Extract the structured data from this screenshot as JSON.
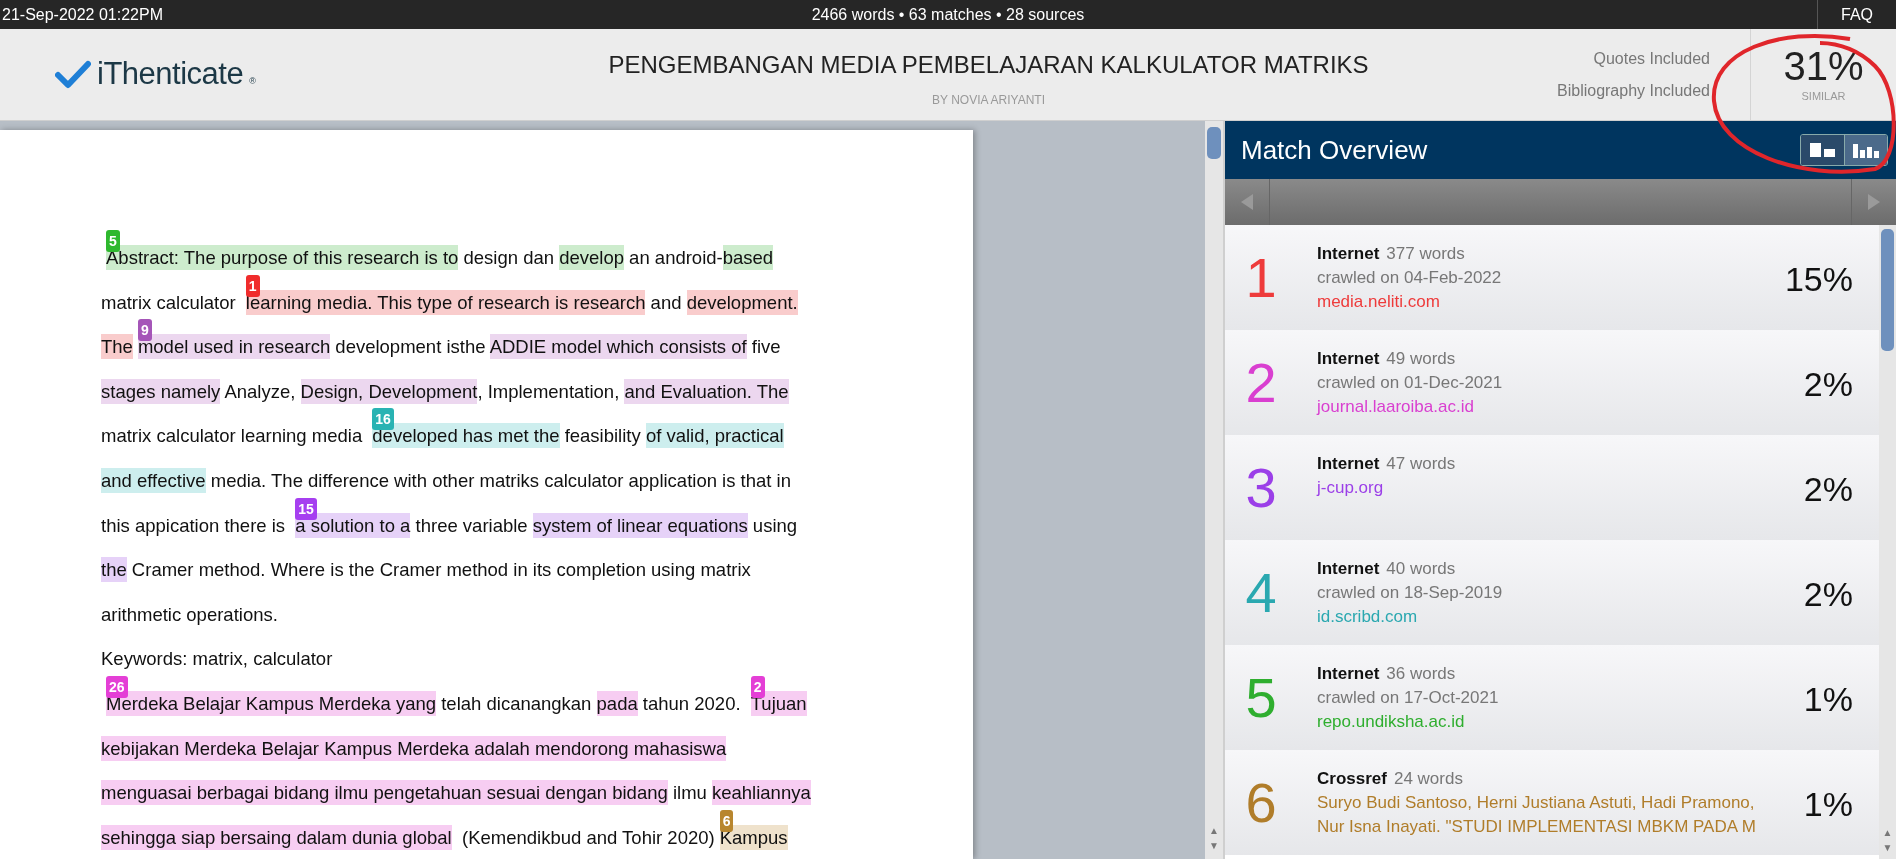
{
  "top_bar": {
    "datetime": "21-Sep-2022 01:22PM",
    "stats": "2466 words • 63 matches • 28 sources",
    "faq": "FAQ"
  },
  "header": {
    "logo_text": "iThenticate",
    "logo_mark": "®",
    "title": "PENGEMBANGAN MEDIA PEMBELAJARAN KALKULATOR MATRIKS",
    "author": "BY NOVIA ARIYANTI",
    "filters": [
      "Quotes Included",
      "Bibliography Included"
    ],
    "similarity": "31%",
    "similarity_label": "SIMILAR"
  },
  "document": {
    "lines": [
      [
        {
          "kind": "marker",
          "text": "5",
          "color": "#2eb82e"
        },
        {
          "kind": "match",
          "text": "Abstract: The purpose of this research is to",
          "color": "#cdeccd"
        },
        {
          "kind": "plain",
          "text": " design dan "
        },
        {
          "kind": "match",
          "text": "develop",
          "color": "#cdeccd"
        },
        {
          "kind": "plain",
          "text": " an android-"
        },
        {
          "kind": "match",
          "text": "based",
          "color": "#cdeccd"
        }
      ],
      [
        {
          "kind": "plain",
          "text": "matrix calculator "
        },
        {
          "kind": "marker",
          "text": "1",
          "color": "#f02c2c"
        },
        {
          "kind": "match",
          "text": "learning media. This type of  research is research",
          "color": "#f9cccc"
        },
        {
          "kind": "plain",
          "text": " and "
        },
        {
          "kind": "match",
          "text": "development.",
          "color": "#f9cccc"
        }
      ],
      [
        {
          "kind": "match",
          "text": "The",
          "color": "#f9cccc"
        },
        {
          "kind": "marker",
          "text": "9",
          "color": "#a555b8"
        },
        {
          "kind": "match",
          "text": "model used in research",
          "color": "#ecd7ef"
        },
        {
          "kind": "plain",
          "text": " development isthe "
        },
        {
          "kind": "match",
          "text": "ADDIE model which consists of",
          "color": "#ecd7ef"
        },
        {
          "kind": "plain",
          "text": " five"
        }
      ],
      [
        {
          "kind": "match",
          "text": "stages namely",
          "color": "#ecd7ef"
        },
        {
          "kind": "plain",
          "text": " Analyze, "
        },
        {
          "kind": "match",
          "text": "Design, Development",
          "color": "#ecd7ef"
        },
        {
          "kind": "plain",
          "text": ", Implementation, "
        },
        {
          "kind": "match",
          "text": "and Evaluation. The",
          "color": "#ecd7ef"
        }
      ],
      [
        {
          "kind": "plain",
          "text": "matrix calculator learning media "
        },
        {
          "kind": "marker",
          "text": "16",
          "color": "#29b3b3"
        },
        {
          "kind": "match",
          "text": "developed has met the",
          "color": "#cdeeee"
        },
        {
          "kind": "plain",
          "text": " feasibility "
        },
        {
          "kind": "match",
          "text": "of valid, practical",
          "color": "#cdeeee"
        }
      ],
      [
        {
          "kind": "match",
          "text": "and effective",
          "color": "#cdeeee"
        },
        {
          "kind": "plain",
          "text": " media. The difference with other matriks calculator application is that in"
        }
      ],
      [
        {
          "kind": "plain",
          "text": "this appication there is "
        },
        {
          "kind": "marker",
          "text": "15",
          "color": "#a63ff0"
        },
        {
          "kind": "match",
          "text": "a solution to a",
          "color": "#e6d2f8"
        },
        {
          "kind": "plain",
          "text": " three variable "
        },
        {
          "kind": "match",
          "text": "system of linear equations",
          "color": "#e6d2f8"
        },
        {
          "kind": "plain",
          "text": " using"
        }
      ],
      [
        {
          "kind": "match",
          "text": "the",
          "color": "#e6d2f8"
        },
        {
          "kind": "plain",
          "text": " Cramer method. Where is the Cramer method in its completion using matrix"
        }
      ],
      [
        {
          "kind": "plain",
          "text": "arithmetic operations."
        }
      ],
      [
        {
          "kind": "plain",
          "text": "Keywords: matrix, calculator"
        }
      ],
      [
        {
          "kind": "marker",
          "text": "26",
          "color": "#e43fd6"
        },
        {
          "kind": "match",
          "text": "Merdeka Belajar Kampus Merdeka yang",
          "color": "#f7cdf2"
        },
        {
          "kind": "plain",
          "text": " telah dicanangkan "
        },
        {
          "kind": "match",
          "text": "pada",
          "color": "#f7cdf2"
        },
        {
          "kind": "plain",
          "text": " tahun 2020. "
        },
        {
          "kind": "marker",
          "text": "2",
          "color": "#e43fd6"
        },
        {
          "kind": "match",
          "text": "Tujuan",
          "color": "#f7cdf2"
        }
      ],
      [
        {
          "kind": "match",
          "text": "kebijakan Merdeka Belajar Kampus Merdeka adalah mendorong mahasiswa",
          "color": "#f7cdf2"
        }
      ],
      [
        {
          "kind": "match",
          "text": "menguasai berbagai bidang ilmu pengetahuan sesuai dengan bidang",
          "color": "#f7cdf2"
        },
        {
          "kind": "plain",
          "text": " ilmu "
        },
        {
          "kind": "match",
          "text": "keahliannya",
          "color": "#f7cdf2"
        }
      ],
      [
        {
          "kind": "match",
          "text": "sehingga siap bersaing dalam dunia global",
          "color": "#f7cdf2"
        },
        {
          "kind": "plain",
          "text": "  (Kemendikbud and Tohir 2020)"
        },
        {
          "kind": "marker",
          "text": "6",
          "color": "#b8862e"
        },
        {
          "kind": "match",
          "text": "Kampus",
          "color": "#efe2cc"
        }
      ]
    ]
  },
  "document_scrollbar": {
    "arrows": [
      "▲",
      "▼"
    ]
  },
  "match_overview": {
    "scroll_arrows": [
      "▲",
      "▼"
    ],
    "title": "Match Overview",
    "matches": [
      {
        "rank": "1",
        "color": "#ee3b3b",
        "source": "Internet",
        "words": "377 words",
        "crawled": "crawled on 04-Feb-2022",
        "link": "media.neliti.com",
        "percent": "15%"
      },
      {
        "rank": "2",
        "color": "#d93fd0",
        "source": "Internet",
        "words": "49 words",
        "crawled": "crawled on 01-Dec-2021",
        "link": "journal.laaroiba.ac.id",
        "percent": "2%"
      },
      {
        "rank": "3",
        "color": "#9b3fe8",
        "source": "Internet",
        "words": "47 words",
        "link": "j-cup.org",
        "percent": "2%"
      },
      {
        "rank": "4",
        "color": "#2aa8b0",
        "source": "Internet",
        "words": "40 words",
        "crawled": "crawled on 18-Sep-2019",
        "link": "id.scribd.com",
        "percent": "2%"
      },
      {
        "rank": "5",
        "color": "#2fae2f",
        "source": "Internet",
        "words": "36 words",
        "crawled": "crawled on 17-Oct-2021",
        "link": "repo.undiksha.ac.id",
        "percent": "1%"
      },
      {
        "rank": "6",
        "color": "#b07d2a",
        "source": "Crossref",
        "words": "24 words",
        "citation": [
          "Suryo Budi Santoso, Herni Justiana Astuti, Hadi Pramono,",
          "Nur Isna Inayati. \"STUDI IMPLEMENTASI MBKM PADA M"
        ],
        "percent": "1%"
      }
    ]
  }
}
